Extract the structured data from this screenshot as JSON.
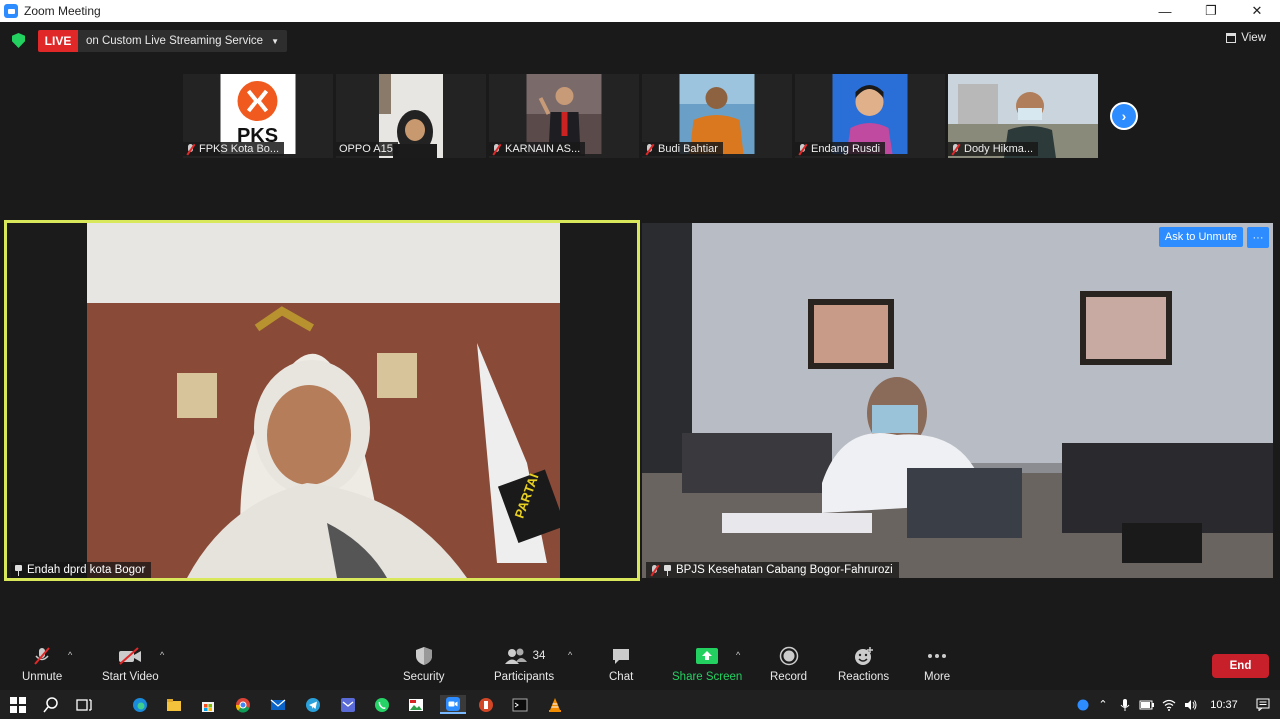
{
  "window": {
    "title": "Zoom Meeting",
    "controls": [
      "—",
      "❐",
      "✕"
    ]
  },
  "live": {
    "badge": "LIVE",
    "service": "on Custom Live Streaming Service",
    "caret": "▼"
  },
  "view_label": "View",
  "thumbnails": [
    {
      "name": "FPKS Kota Bo...",
      "icon": "pks-logo",
      "muted": true
    },
    {
      "name": "OPPO A15",
      "icon": "person-hijab",
      "muted": false
    },
    {
      "name": "KARNAIN AS...",
      "icon": "person-suit",
      "muted": true
    },
    {
      "name": "Budi Bahtiar",
      "icon": "person-orange-shirt",
      "muted": true
    },
    {
      "name": "Endang Rusdi",
      "icon": "child-portrait",
      "muted": true
    },
    {
      "name": "Dody Hikma...",
      "icon": "person-mask-outdoor",
      "muted": true
    }
  ],
  "pks_logo_text": "PKS",
  "next_arrow": "›",
  "main_tiles": {
    "left": {
      "name": "Endah dprd kota Bogor",
      "pinned": true,
      "active_speaker_color": "#d9e85a",
      "flag_text": "PARTAI"
    },
    "right": {
      "name": "BPJS Kesehatan Cabang Bogor-Fahrurozi",
      "pinned": true,
      "muted": true,
      "ask_unmute": "Ask to Unmute",
      "more": "···"
    }
  },
  "toolbar": {
    "unmute": "Unmute",
    "start_video": "Start Video",
    "security": "Security",
    "participants": "Participants",
    "participants_count": "34",
    "chat": "Chat",
    "share_screen": "Share Screen",
    "record": "Record",
    "reactions": "Reactions",
    "more": "More",
    "end": "End",
    "caret": "^"
  },
  "taskbar": {
    "clock": "10:37",
    "apps": [
      "windows-icon",
      "search-icon",
      "task-view-icon",
      "edge-icon",
      "file-explorer-icon",
      "store-icon",
      "chrome-icon",
      "mail-icon",
      "telegram-icon",
      "mail-blue-icon",
      "whatsapp-icon",
      "gallery-icon",
      "zoom-icon",
      "powerpoint-icon",
      "terminal-icon",
      "vlc-icon"
    ]
  },
  "colors": {
    "accent_blue": "#2d8cff",
    "live_red": "#e02828",
    "share_green": "#23d160",
    "end_red": "#c8202a"
  }
}
